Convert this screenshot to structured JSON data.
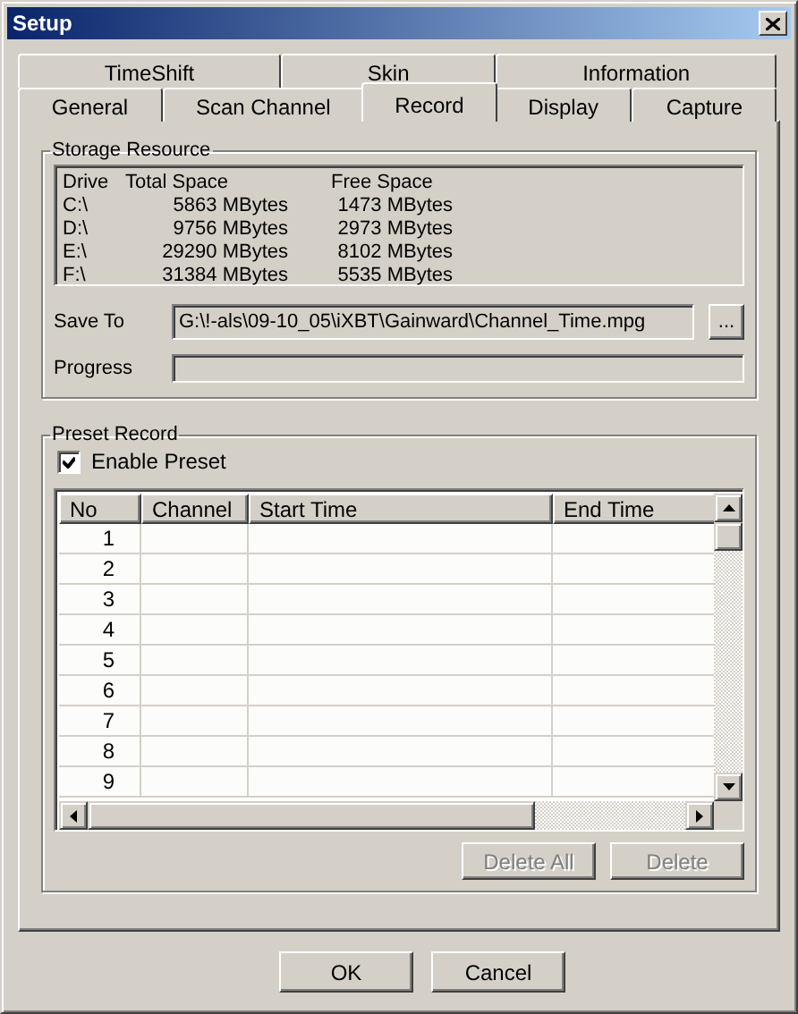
{
  "window": {
    "title": "Setup"
  },
  "tab_rows": [
    [
      {
        "label": "TimeShift",
        "selected": false
      },
      {
        "label": "Skin",
        "selected": false
      },
      {
        "label": "Information",
        "selected": false
      }
    ],
    [
      {
        "label": "General",
        "selected": false
      },
      {
        "label": "Scan Channel",
        "selected": false
      },
      {
        "label": "Record",
        "selected": true
      },
      {
        "label": "Display",
        "selected": false
      },
      {
        "label": "Capture",
        "selected": false
      }
    ]
  ],
  "storage": {
    "title": "Storage Resource",
    "columns": [
      "Drive",
      "Total Space",
      "Free Space"
    ],
    "rows": [
      [
        "C:\\",
        "5863 MBytes",
        "1473 MBytes"
      ],
      [
        "D:\\",
        "9756 MBytes",
        "2973 MBytes"
      ],
      [
        "E:\\",
        "29290 MBytes",
        "8102 MBytes"
      ],
      [
        "F:\\",
        "31384 MBytes",
        "5535 MBytes"
      ]
    ],
    "save_to": {
      "label": "Save To",
      "value": "G:\\!-als\\09-10_05\\iXBT\\Gainward\\Channel_Time.mpg",
      "browse": "..."
    },
    "progress": {
      "label": "Progress",
      "level": 0
    }
  },
  "preset": {
    "title": "Preset Record",
    "enable": {
      "label": "Enable Preset",
      "checked": true
    },
    "columns": [
      "No",
      "Channel",
      "Start Time",
      "End Time"
    ],
    "rows": [
      [
        "1",
        "",
        "",
        ""
      ],
      [
        "2",
        "",
        "",
        ""
      ],
      [
        "3",
        "",
        "",
        ""
      ],
      [
        "4",
        "",
        "",
        ""
      ],
      [
        "5",
        "",
        "",
        ""
      ],
      [
        "6",
        "",
        "",
        ""
      ],
      [
        "7",
        "",
        "",
        ""
      ],
      [
        "8",
        "",
        "",
        ""
      ],
      [
        "9",
        "",
        "",
        ""
      ]
    ],
    "buttons": [
      {
        "label": "Delete All",
        "disabled": true
      },
      {
        "label": "Delete",
        "disabled": true
      }
    ]
  },
  "buttons": [
    {
      "label": "OK",
      "disabled": false
    },
    {
      "label": "Cancel",
      "disabled": false
    }
  ]
}
